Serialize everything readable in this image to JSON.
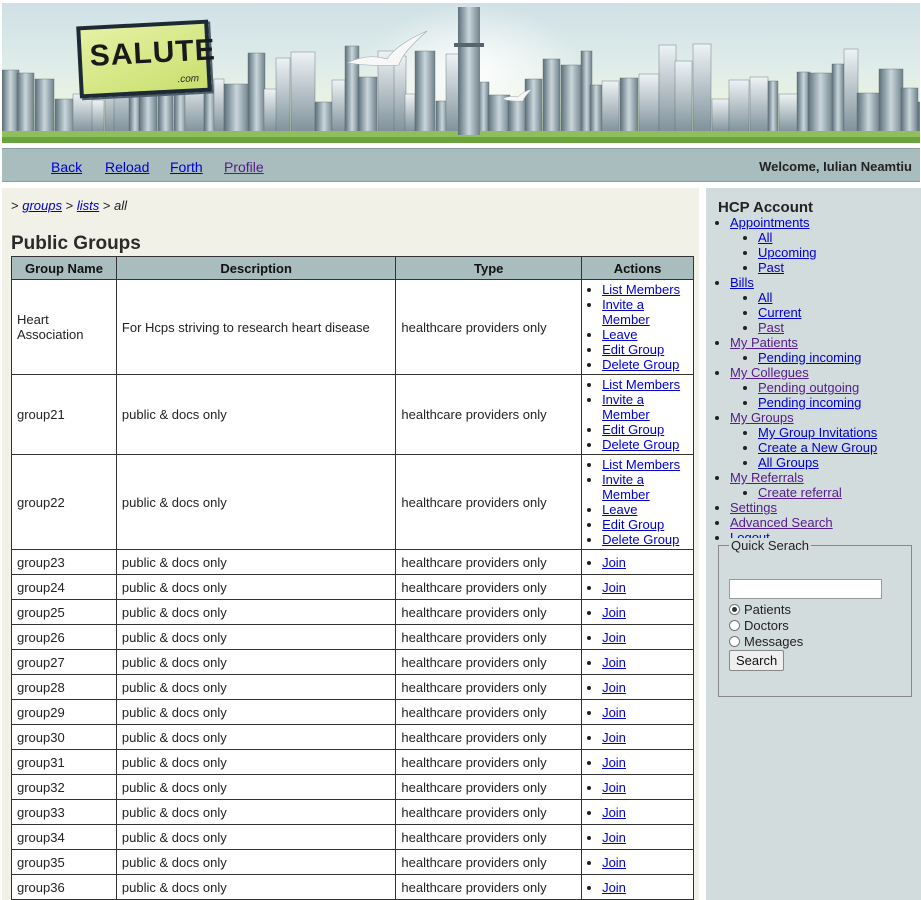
{
  "logo": {
    "text": "SALUTE",
    "sub": ".com"
  },
  "nav": {
    "back": "Back",
    "reload": "Reload",
    "forth": "Forth",
    "profile": "Profile",
    "welcome": "Welcome, Iulian Neamtiu"
  },
  "breadcrumb": {
    "prefix": ">",
    "groups": "groups",
    "sep1": ">",
    "lists": "lists",
    "sep2": ">",
    "current": "all"
  },
  "page_title": "Public Groups",
  "table": {
    "headers": [
      "Group Name",
      "Description",
      "Type",
      "Actions"
    ],
    "rows": [
      {
        "name": "Heart Association",
        "description": "For Hcps striving to research heart disease",
        "type": "healthcare providers only",
        "actions": [
          "List Members",
          "Invite a Member",
          "Leave",
          "Edit Group",
          "Delete Group"
        ]
      },
      {
        "name": "group21",
        "description": "public & docs only",
        "type": "healthcare providers only",
        "actions": [
          "List Members",
          "Invite a Member",
          "Edit Group",
          "Delete Group"
        ]
      },
      {
        "name": "group22",
        "description": "public & docs only",
        "type": "healthcare providers only",
        "actions": [
          "List Members",
          "Invite a Member",
          "Leave",
          "Edit Group",
          "Delete Group"
        ]
      },
      {
        "name": "group23",
        "description": "public & docs only",
        "type": "healthcare providers only",
        "actions": [
          "Join"
        ]
      },
      {
        "name": "group24",
        "description": "public & docs only",
        "type": "healthcare providers only",
        "actions": [
          "Join"
        ]
      },
      {
        "name": "group25",
        "description": "public & docs only",
        "type": "healthcare providers only",
        "actions": [
          "Join"
        ]
      },
      {
        "name": "group26",
        "description": "public & docs only",
        "type": "healthcare providers only",
        "actions": [
          "Join"
        ]
      },
      {
        "name": "group27",
        "description": "public & docs only",
        "type": "healthcare providers only",
        "actions": [
          "Join"
        ]
      },
      {
        "name": "group28",
        "description": "public & docs only",
        "type": "healthcare providers only",
        "actions": [
          "Join"
        ]
      },
      {
        "name": "group29",
        "description": "public & docs only",
        "type": "healthcare providers only",
        "actions": [
          "Join"
        ]
      },
      {
        "name": "group30",
        "description": "public & docs only",
        "type": "healthcare providers only",
        "actions": [
          "Join"
        ]
      },
      {
        "name": "group31",
        "description": "public & docs only",
        "type": "healthcare providers only",
        "actions": [
          "Join"
        ]
      },
      {
        "name": "group32",
        "description": "public & docs only",
        "type": "healthcare providers only",
        "actions": [
          "Join"
        ]
      },
      {
        "name": "group33",
        "description": "public & docs only",
        "type": "healthcare providers only",
        "actions": [
          "Join"
        ]
      },
      {
        "name": "group34",
        "description": "public & docs only",
        "type": "healthcare providers only",
        "actions": [
          "Join"
        ]
      },
      {
        "name": "group35",
        "description": "public & docs only",
        "type": "healthcare providers only",
        "actions": [
          "Join"
        ]
      },
      {
        "name": "group36",
        "description": "public & docs only",
        "type": "healthcare providers only",
        "actions": [
          "Join"
        ]
      }
    ]
  },
  "sidebar": {
    "title": "HCP Account",
    "menu": [
      {
        "label": "Appointments",
        "visited": false,
        "children": [
          {
            "label": "All",
            "visited": false
          },
          {
            "label": "Upcoming",
            "visited": false
          },
          {
            "label": "Past",
            "visited": false
          }
        ]
      },
      {
        "label": "Bills",
        "visited": false,
        "children": [
          {
            "label": "All",
            "visited": false
          },
          {
            "label": "Current",
            "visited": false
          },
          {
            "label": "Past",
            "visited": true
          }
        ]
      },
      {
        "label": "My Patients",
        "visited": true,
        "children": [
          {
            "label": "Pending incoming",
            "visited": false
          }
        ]
      },
      {
        "label": "My Collegues",
        "visited": true,
        "children": [
          {
            "label": "Pending outgoing",
            "visited": true
          },
          {
            "label": "Pending incoming",
            "visited": false
          }
        ]
      },
      {
        "label": "My Groups",
        "visited": true,
        "children": [
          {
            "label": "My Group Invitations",
            "visited": false
          },
          {
            "label": "Create a New Group",
            "visited": false
          },
          {
            "label": "All Groups",
            "visited": false
          }
        ]
      },
      {
        "label": "My Referrals",
        "visited": true,
        "children": [
          {
            "label": "Create referral",
            "visited": true
          }
        ]
      },
      {
        "label": "Settings",
        "visited": true,
        "children": []
      },
      {
        "label": "Advanced Search",
        "visited": true,
        "children": []
      },
      {
        "label": "Logout",
        "visited": false,
        "children": []
      }
    ],
    "quick_search": {
      "legend": "Quick Serach",
      "input_value": "",
      "options": [
        "Patients",
        "Doctors",
        "Messages"
      ],
      "selected": "Patients",
      "button": "Search"
    }
  },
  "colors": {
    "link": "#0000cc",
    "visited": "#551a8b",
    "header_bg": "#a9bcbe",
    "main_bg": "#f1f1e7",
    "sidebar_bg": "#d3dcdc"
  }
}
